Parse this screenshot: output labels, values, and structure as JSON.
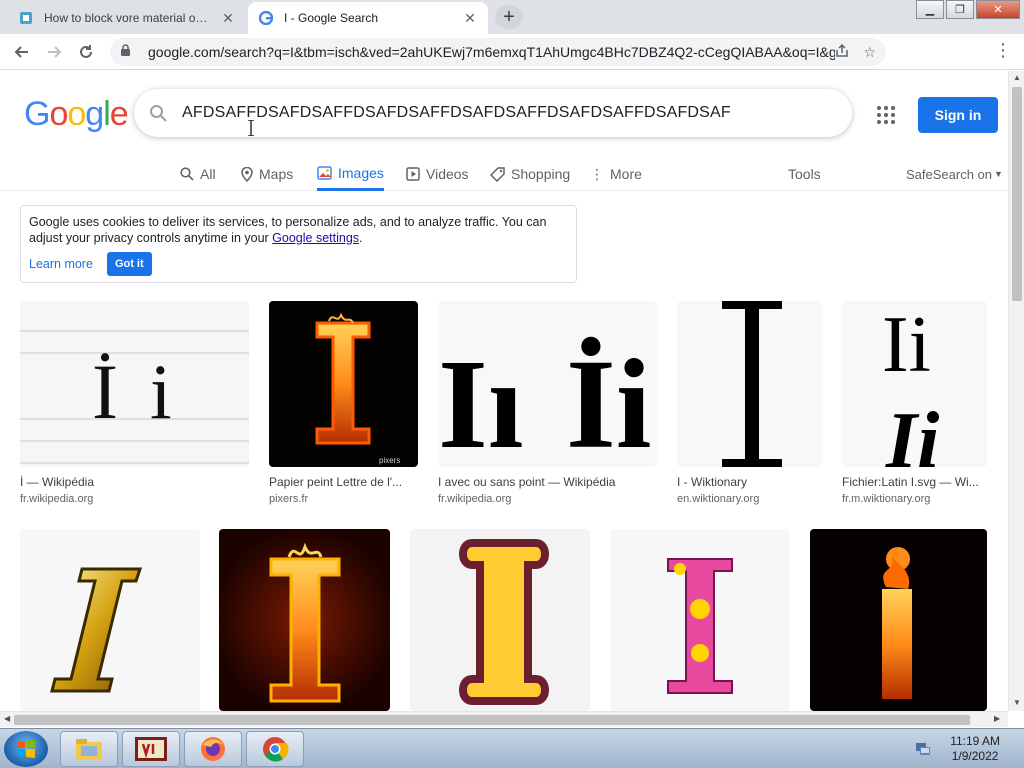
{
  "browser": {
    "tabs": [
      {
        "title": "How to block vore material on m",
        "active": false
      },
      {
        "title": "I - Google Search",
        "active": true
      }
    ],
    "url": "google.com/search?q=I&tbm=isch&ved=2ahUKEwj7m6emxqT1AhUmgc4BHc7DBZ4Q2-cCegQIABAA&oq=I&gs_lcp=..."
  },
  "google": {
    "logo": [
      "G",
      "o",
      "o",
      "g",
      "l",
      "e"
    ],
    "logo_colors": [
      "#4285f4",
      "#ea4335",
      "#fbbc05",
      "#4285f4",
      "#34a853",
      "#ea4335"
    ],
    "query": "AFDSAFFDSAFDSAFFDSAFDSAFFDSAFDSAFFDSAFDSAFFDSAFDSAF",
    "signin": "Sign in",
    "nav": [
      "All",
      "Maps",
      "Images",
      "Videos",
      "Shopping",
      "More"
    ],
    "tools": "Tools",
    "safesearch": "SafeSearch on"
  },
  "cookie": {
    "text_before": "Google uses cookies to deliver its services, to personalize ads, and to analyze traffic. You can adjust your privacy controls anytime in your ",
    "link": "Google settings",
    "text_after": ".",
    "learn_more": "Learn more",
    "got_it": "Got it"
  },
  "results": [
    {
      "caption": "İ — Wikipédia",
      "source": "fr.wikipedia.org"
    },
    {
      "caption": "Papier peint Lettre de l'...",
      "source": "pixers.fr",
      "watermark": "pixers"
    },
    {
      "caption": "I avec ou sans point — Wikipédia",
      "source": "fr.wikipedia.org"
    },
    {
      "caption": "I - Wiktionary",
      "source": "en.wiktionary.org"
    },
    {
      "caption": "Fichier:Latin I.svg — Wi...",
      "source": "fr.m.wiktionary.org"
    }
  ],
  "taskbar": {
    "time": "11:19 AM",
    "date": "1/9/2022"
  }
}
